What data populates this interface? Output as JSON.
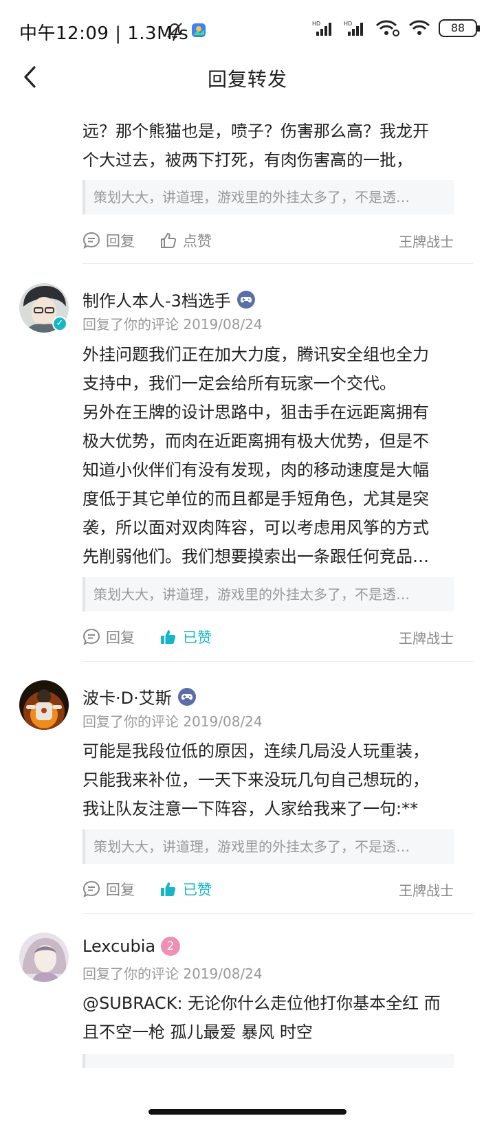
{
  "status_bar": {
    "time": "中午12:09",
    "speed": "1.3M/s",
    "battery": "88",
    "hd1": "HD",
    "hd2": "HD"
  },
  "header": {
    "title": "回复转发"
  },
  "quote_text": "策划大大，讲道理，游戏里的外挂太多了，不是透…",
  "reply_label": "回复",
  "like_label": "点赞",
  "liked_label": "已赞",
  "topic": "王牌战士",
  "comments": [
    {
      "body_lines": [
        "远？那个熊猫也是，喷子？伤害那么高？我龙开",
        "个大过去，被两下打死，有肉伤害高的一批，"
      ]
    },
    {
      "name": "制作人本人-3档选手",
      "meta": "回复了你的评论 2019/08/24",
      "body_lines": [
        "外挂问题我们正在加大力度，腾讯安全组也全力",
        "支持中，我们一定会给所有玩家一个交代。",
        "另外在王牌的设计思路中，狙击手在远距离拥有",
        "极大优势，而肉在近距离拥有极大优势，但是不",
        "知道小伙伴们有没有发现，肉的移动速度是大幅",
        "度低于其它单位的而且都是手短角色，尤其是突",
        "袭，所以面对双肉阵容，可以考虑用风筝的方式",
        "先削弱他们。我们想要摸索出一条跟任何竞品…"
      ]
    },
    {
      "name": "波卡·D·艾斯",
      "meta": "回复了你的评论 2019/08/24",
      "body_lines": [
        "可能是我段位低的原因，连续几局没人玩重装，",
        "只能我来补位，一天下来没玩几句自己想玩的，",
        "我让队友注意一下阵容，人家给我来了一句:**"
      ]
    },
    {
      "name": "Lexcubia",
      "level": "2",
      "meta": "回复了你的评论 2019/08/24",
      "body_lines": [
        "@SUBRACK: 无论你什么走位他打你基本全红 而",
        "且不空一枪 孤儿最爱 暴风 时空"
      ]
    }
  ],
  "colors": {
    "accent": "#17b6c7",
    "pink_badge": "#ef8fb6",
    "game_badge": "#5b6ea8"
  }
}
